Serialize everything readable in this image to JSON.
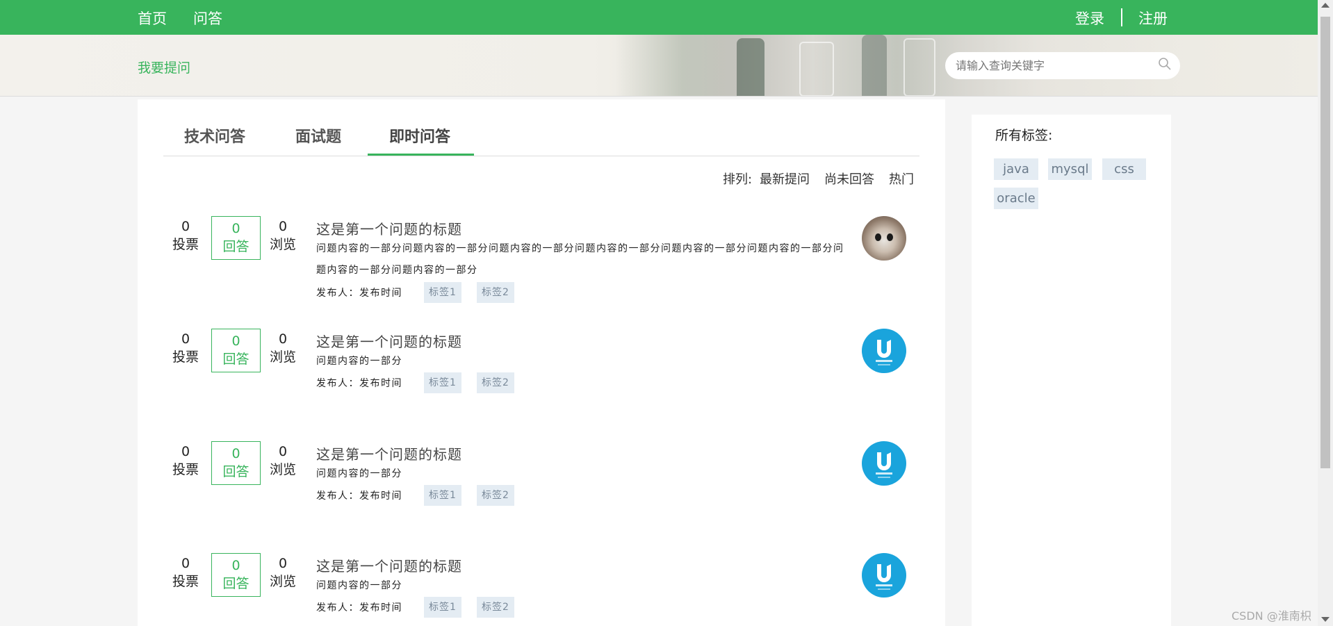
{
  "nav": {
    "home": "首页",
    "qa": "问答",
    "login": "登录",
    "register": "注册"
  },
  "hero": {
    "ask": "我要提问",
    "search_placeholder": "请输入查询关键字"
  },
  "tabs": {
    "tech": "技术问答",
    "interview": "面试题",
    "instant": "即时问答"
  },
  "sort": {
    "label": "排列:",
    "latest": "最新提问",
    "unanswered": "尚未回答",
    "hot": "热门"
  },
  "questions": [
    {
      "votes": "0",
      "votes_label": "投票",
      "answers": "0",
      "answers_label": "回答",
      "views": "0",
      "views_label": "浏览",
      "title": "这是第一个问题的标题",
      "content": "问题内容的一部分问题内容的一部分问题内容的一部分问题内容的一部分问题内容的一部分问题内容的一部分问题内容的一部分问题内容的一部分",
      "meta": "发布人：发布时间",
      "tag1": "标签1",
      "tag2": "标签2",
      "avatar": "cat-avatar"
    },
    {
      "votes": "0",
      "votes_label": "投票",
      "answers": "0",
      "answers_label": "回答",
      "views": "0",
      "views_label": "浏览",
      "title": "这是第一个问题的标题",
      "content": "问题内容的一部分",
      "meta": "发布人：发布时间",
      "tag1": "标签1",
      "tag2": "标签2",
      "avatar": "udacity-avatar"
    },
    {
      "votes": "0",
      "votes_label": "投票",
      "answers": "0",
      "answers_label": "回答",
      "views": "0",
      "views_label": "浏览",
      "title": "这是第一个问题的标题",
      "content": "问题内容的一部分",
      "meta": "发布人：发布时间",
      "tag1": "标签1",
      "tag2": "标签2",
      "avatar": "udacity-avatar"
    },
    {
      "votes": "0",
      "votes_label": "投票",
      "answers": "0",
      "answers_label": "回答",
      "views": "0",
      "views_label": "浏览",
      "title": "这是第一个问题的标题",
      "content": "问题内容的一部分",
      "meta": "发布人：发布时间",
      "tag1": "标签1",
      "tag2": "标签2",
      "avatar": "udacity-avatar"
    }
  ],
  "sidebar": {
    "title": "所有标签:",
    "tags": [
      "java",
      "mysql",
      "css",
      "oracle"
    ]
  },
  "watermark": "CSDN @淮南枳",
  "colors": {
    "brand": "#38b45c",
    "tag_bg": "#e4ecf3",
    "avatar_blue": "#1aa4dc"
  }
}
